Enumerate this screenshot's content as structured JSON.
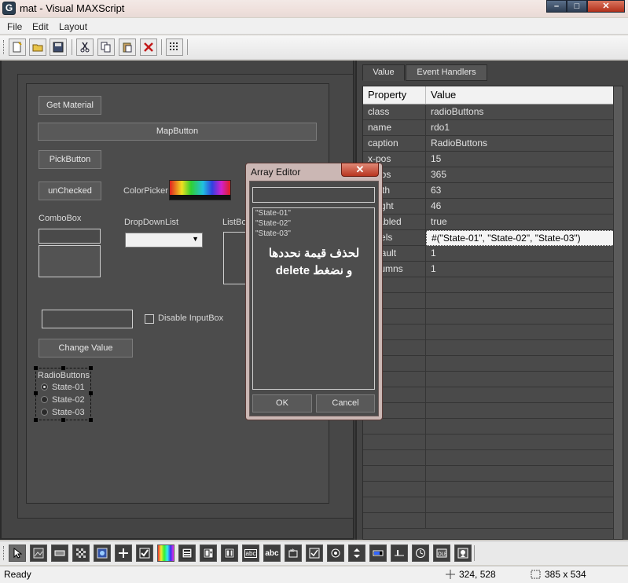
{
  "window": {
    "title": "mat - Visual MAXScript",
    "icon_letter": "G",
    "controls": [
      "minimize",
      "maximize",
      "close"
    ]
  },
  "menu": [
    "File",
    "Edit",
    "Layout"
  ],
  "toolbar": [
    "new",
    "open",
    "save",
    "cut",
    "copy",
    "paste",
    "delete",
    "grid"
  ],
  "form": {
    "get_material": "Get Material",
    "map_button": "MapButton",
    "pick_button": "PickButton",
    "unchecked": "unChecked",
    "colorpicker_label": "ColorPicker",
    "combobox_label": "ComboBox",
    "dropdown_label": "DropDownList",
    "listbox_label": "ListBox",
    "disable_inputbox": "Disable InputBox",
    "change_value": "Change Value",
    "radio_group_label": "RadioButtons",
    "radio_options": [
      "State-01",
      "State-02",
      "State-03"
    ]
  },
  "properties": {
    "tabs": [
      "Value",
      "Event Handlers"
    ],
    "headers": [
      "Property",
      "Value"
    ],
    "rows": [
      [
        "class",
        "radioButtons"
      ],
      [
        "name",
        "rdo1"
      ],
      [
        "caption",
        "RadioButtons"
      ],
      [
        "x-pos",
        "15"
      ],
      [
        "y-pos",
        "365"
      ],
      [
        "width",
        "63"
      ],
      [
        "height",
        "46"
      ],
      [
        "enabled",
        "true"
      ],
      [
        "labels",
        "#(\"State-01\", \"State-02\", \"State-03\")"
      ],
      [
        "default",
        "1"
      ],
      [
        "columns",
        "1"
      ]
    ]
  },
  "array_editor": {
    "title": "Array Editor",
    "input_value": "",
    "items": [
      "\"State-01\"",
      "\"State-02\"",
      "\"State-03\""
    ],
    "note_line1": "لحذف قيمة نحددها",
    "note_line2": "و نضغط delete",
    "ok": "OK",
    "cancel": "Cancel"
  },
  "bottom_toolbar": [
    "pointer",
    "bitmap",
    "button",
    "checker",
    "mapbutton",
    "pickbutton",
    "checkbox",
    "colorpicker",
    "combobox",
    "listbox",
    "edittext",
    "label",
    "groupbox",
    "checkbutton",
    "radio",
    "spinner",
    "progressbar",
    "slider",
    "timer",
    "activex",
    "image"
  ],
  "bottom_labels": {
    "label": "abc",
    "group": "abc",
    "edit": "abc"
  },
  "status": {
    "text": "Ready",
    "position": "324, 528",
    "size": "385 x 534"
  }
}
